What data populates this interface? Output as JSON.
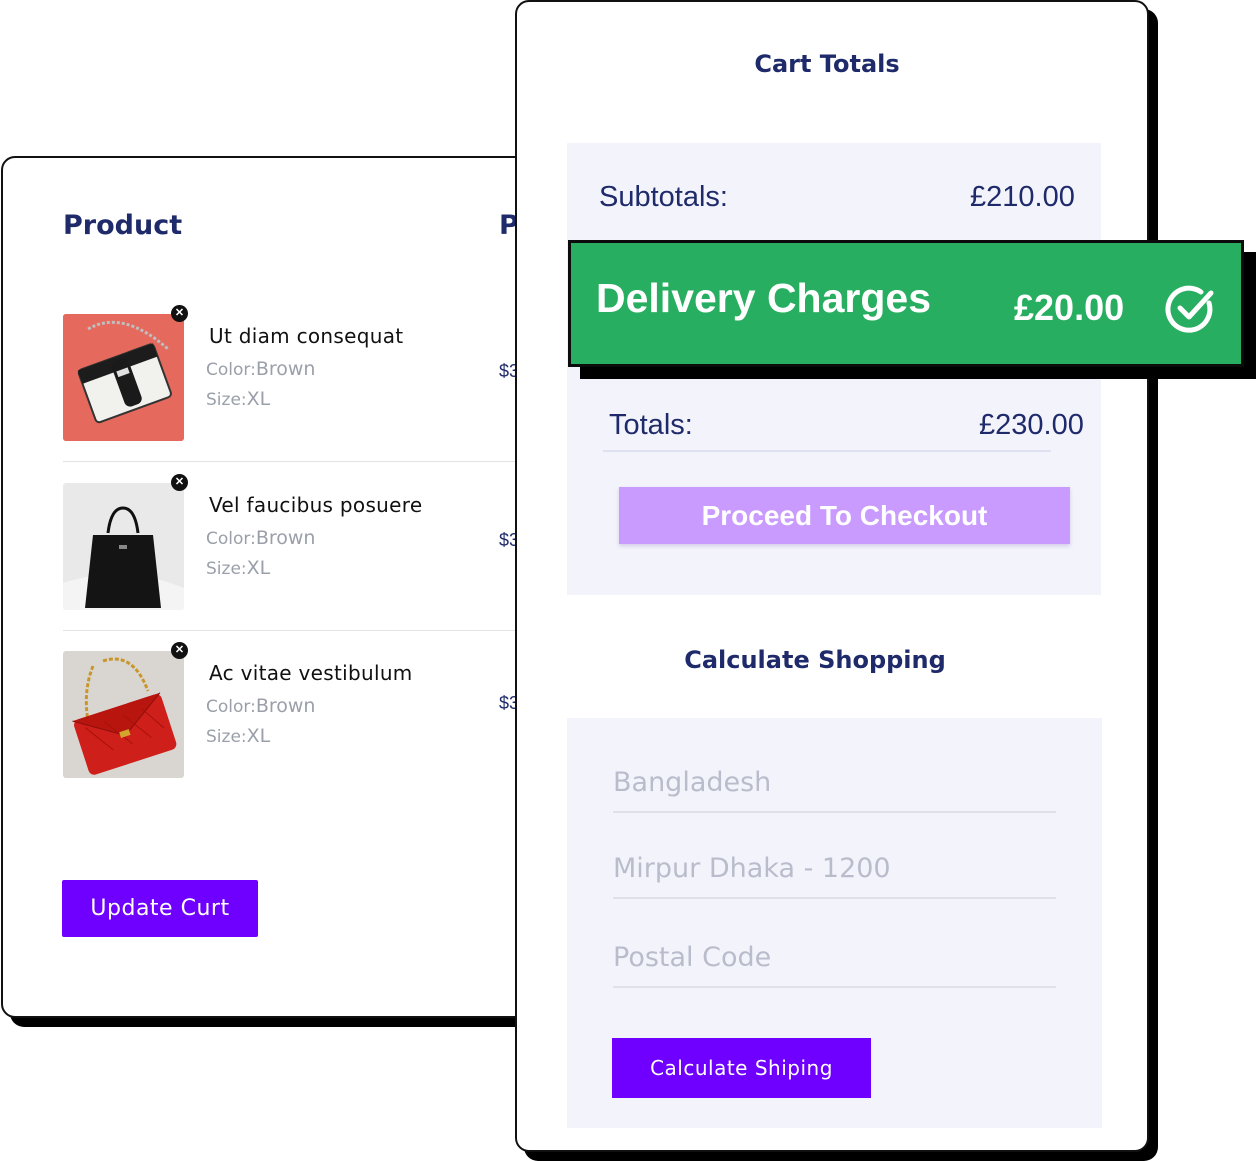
{
  "cart": {
    "product_heading": "Product",
    "price_heading_partial": "P",
    "items": [
      {
        "name": "Ut diam consequat",
        "color_label": "Color:",
        "color": "Brown",
        "size_label": "Size:",
        "size": "XL",
        "price_partial": "$3",
        "image": "white-black-handbag"
      },
      {
        "name": "Vel faucibus posuere",
        "color_label": "Color:",
        "color": "Brown",
        "size_label": "Size:",
        "size": "XL",
        "price_partial": "$3",
        "image": "black-tote-bag"
      },
      {
        "name": "Ac vitae vestibulum",
        "color_label": "Color:",
        "color": "Brown",
        "size_label": "Size:",
        "size": "XL",
        "price_partial": "$3",
        "image": "red-quilted-bag"
      }
    ],
    "update_button": "Update Curt"
  },
  "totals": {
    "title": "Cart Totals",
    "subtotal_label": "Subtotals:",
    "subtotal_value": "£210.00",
    "delivery_label": "Delivery Charges",
    "delivery_value": "£20.00",
    "total_label": "Totals:",
    "total_value": "£230.00",
    "checkout_button": "Proceed To Checkout"
  },
  "shipping": {
    "title": "Calculate Shopping",
    "country_placeholder": "Bangladesh",
    "city_placeholder": "Mirpur Dhaka - 1200",
    "postal_placeholder": "Postal Code",
    "calculate_button": "Calculate Shiping"
  },
  "colors": {
    "accent_purple": "#6f00ff",
    "checkout_lilac": "#c99bff",
    "delivery_green": "#27ae60",
    "navy_text": "#1f2a6b"
  }
}
